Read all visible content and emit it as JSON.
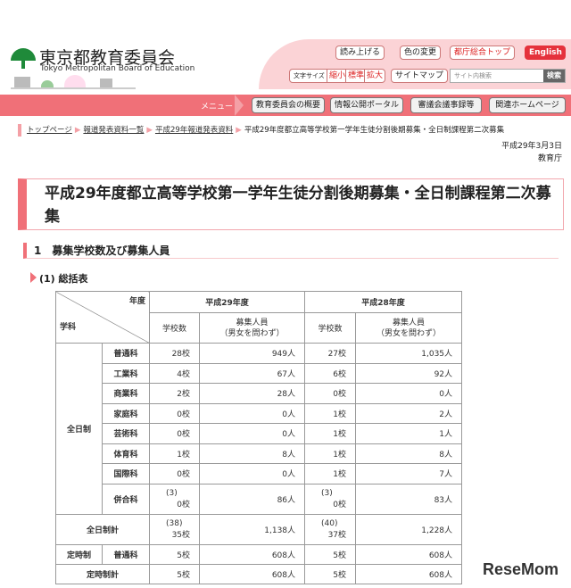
{
  "header": {
    "logo_jp": "東京都教育委員会",
    "logo_en": "Tokyo Metropolitan Board of Education",
    "read_aloud": "読み上げる",
    "color_change": "色の変更",
    "metro_top": "都庁総合トップ",
    "english": "English",
    "font_size_label": "文字サイズ",
    "font_small": "縮小",
    "font_normal": "標準",
    "font_large": "拡大",
    "sitemap": "サイトマップ",
    "search_placeholder": "サイト内検索",
    "search_button": "検索"
  },
  "menu": {
    "label": "メニュー",
    "items": [
      "教育委員会の概要",
      "情報公開ポータル",
      "審議会議事録等",
      "関連ホームページ"
    ]
  },
  "breadcrumb": [
    "トップページ",
    "報道発表資料一覧",
    "平成29年報道発表資料",
    "平成29年度都立高等学校第一学年生徒分割後期募集・全日制課程第二次募集"
  ],
  "date": "平成29年3月3日",
  "issuer": "教育庁",
  "title": "平成29年度都立高等学校第一学年生徒分割後期募集・全日制課程第二次募集",
  "section1": "1　募集学校数及び募集人員",
  "subsection": "(1) 総括表",
  "table": {
    "year_label": "年度",
    "dept_label": "学科",
    "year1": "平成29年度",
    "year2": "平成28年度",
    "schools": "学校数",
    "recruit": "募集人員\n（男女を問わず）",
    "fulltime": "全日制",
    "rows": [
      {
        "name": "普通科",
        "s1": "28校",
        "p1": "949人",
        "s2": "27校",
        "p2": "1,035人"
      },
      {
        "name": "工業科",
        "s1": "4校",
        "p1": "67人",
        "s2": "6校",
        "p2": "92人"
      },
      {
        "name": "商業科",
        "s1": "2校",
        "p1": "28人",
        "s2": "0校",
        "p2": "0人"
      },
      {
        "name": "家庭科",
        "s1": "0校",
        "p1": "0人",
        "s2": "1校",
        "p2": "2人"
      },
      {
        "name": "芸術科",
        "s1": "0校",
        "p1": "0人",
        "s2": "1校",
        "p2": "1人"
      },
      {
        "name": "体育科",
        "s1": "1校",
        "p1": "8人",
        "s2": "1校",
        "p2": "8人"
      },
      {
        "name": "国際科",
        "s1": "0校",
        "p1": "0人",
        "s2": "1校",
        "p2": "7人"
      },
      {
        "name": "併合科",
        "s1a": "(3)",
        "s1": "0校",
        "p1": "86人",
        "s2a": "(3)",
        "s2": "0校",
        "p2": "83人"
      }
    ],
    "fulltime_total": {
      "name": "全日制計",
      "s1a": "(38)",
      "s1": "35校",
      "p1": "1,138人",
      "s2a": "(40)",
      "s2": "37校",
      "p2": "1,228人"
    },
    "parttime": {
      "group": "定時制",
      "name": "普通科",
      "s1": "5校",
      "p1": "608人",
      "s2": "5校",
      "p2": "608人"
    },
    "parttime_total": {
      "name": "定時制計",
      "s1": "5校",
      "p1": "608人",
      "s2": "5校",
      "p2": "608人"
    }
  },
  "watermark": "ReseMom",
  "colors": {
    "accent": "#f07078",
    "pink": "#fbd3d6",
    "logo_green": "#1f8a3a"
  }
}
